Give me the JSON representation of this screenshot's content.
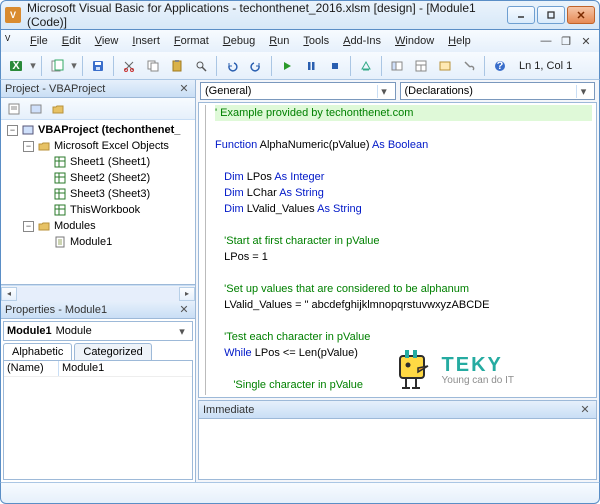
{
  "title": "Microsoft Visual Basic for Applications - techonthenet_2016.xlsm [design] - [Module1 (Code)]",
  "menus": [
    "File",
    "Edit",
    "View",
    "Insert",
    "Format",
    "Debug",
    "Run",
    "Tools",
    "Add-Ins",
    "Window",
    "Help"
  ],
  "cursor": "Ln 1, Col 1",
  "project_panel": {
    "title": "Project - VBAProject"
  },
  "tree": {
    "root": "VBAProject (techonthenet_",
    "grp1": "Microsoft Excel Objects",
    "s1": "Sheet1 (Sheet1)",
    "s2": "Sheet2 (Sheet2)",
    "s3": "Sheet3 (Sheet3)",
    "wb": "ThisWorkbook",
    "grp2": "Modules",
    "m1": "Module1"
  },
  "props_panel": {
    "title": "Properties - Module1"
  },
  "props": {
    "combo_name": "Module1",
    "combo_type": "Module",
    "tabs": [
      "Alphabetic",
      "Categorized"
    ],
    "rows": [
      {
        "name": "(Name)",
        "value": "Module1"
      }
    ]
  },
  "code_dd": {
    "left": "(General)",
    "right": "(Declarations)"
  },
  "code_lines": [
    {
      "cls": "c-cm hl",
      "t": "' Example provided by techonthenet.com"
    },
    {
      "cls": "",
      "t": ""
    },
    {
      "cls": "",
      "seg": [
        {
          "c": "c-kw",
          "t": "Function"
        },
        {
          "t": " AlphaNumeric(pValue) "
        },
        {
          "c": "c-kw",
          "t": "As Boolean"
        }
      ]
    },
    {
      "cls": "",
      "t": ""
    },
    {
      "cls": "",
      "seg": [
        {
          "t": "   "
        },
        {
          "c": "c-kw",
          "t": "Dim"
        },
        {
          "t": " LPos "
        },
        {
          "c": "c-kw",
          "t": "As Integer"
        }
      ]
    },
    {
      "cls": "",
      "seg": [
        {
          "t": "   "
        },
        {
          "c": "c-kw",
          "t": "Dim"
        },
        {
          "t": " LChar "
        },
        {
          "c": "c-kw",
          "t": "As String"
        }
      ]
    },
    {
      "cls": "",
      "seg": [
        {
          "t": "   "
        },
        {
          "c": "c-kw",
          "t": "Dim"
        },
        {
          "t": " LValid_Values "
        },
        {
          "c": "c-kw",
          "t": "As String"
        }
      ]
    },
    {
      "cls": "",
      "t": ""
    },
    {
      "cls": "c-cm",
      "t": "   'Start at first character in pValue"
    },
    {
      "cls": "",
      "t": "   LPos = 1"
    },
    {
      "cls": "",
      "t": ""
    },
    {
      "cls": "c-cm",
      "t": "   'Set up values that are considered to be alphanum"
    },
    {
      "cls": "",
      "t": "   LValid_Values = \" abcdefghijklmnopqrstuvwxyzABCDE"
    },
    {
      "cls": "",
      "t": ""
    },
    {
      "cls": "c-cm",
      "t": "   'Test each character in pValue"
    },
    {
      "cls": "",
      "seg": [
        {
          "t": "   "
        },
        {
          "c": "c-kw",
          "t": "While"
        },
        {
          "t": " LPos <= Len(pValue)"
        }
      ]
    },
    {
      "cls": "",
      "t": ""
    },
    {
      "cls": "c-cm",
      "t": "      'Single character in pValue"
    }
  ],
  "immediate": {
    "title": "Immediate"
  },
  "watermark": {
    "brand": "TEKY",
    "tag": "Young can do IT"
  }
}
